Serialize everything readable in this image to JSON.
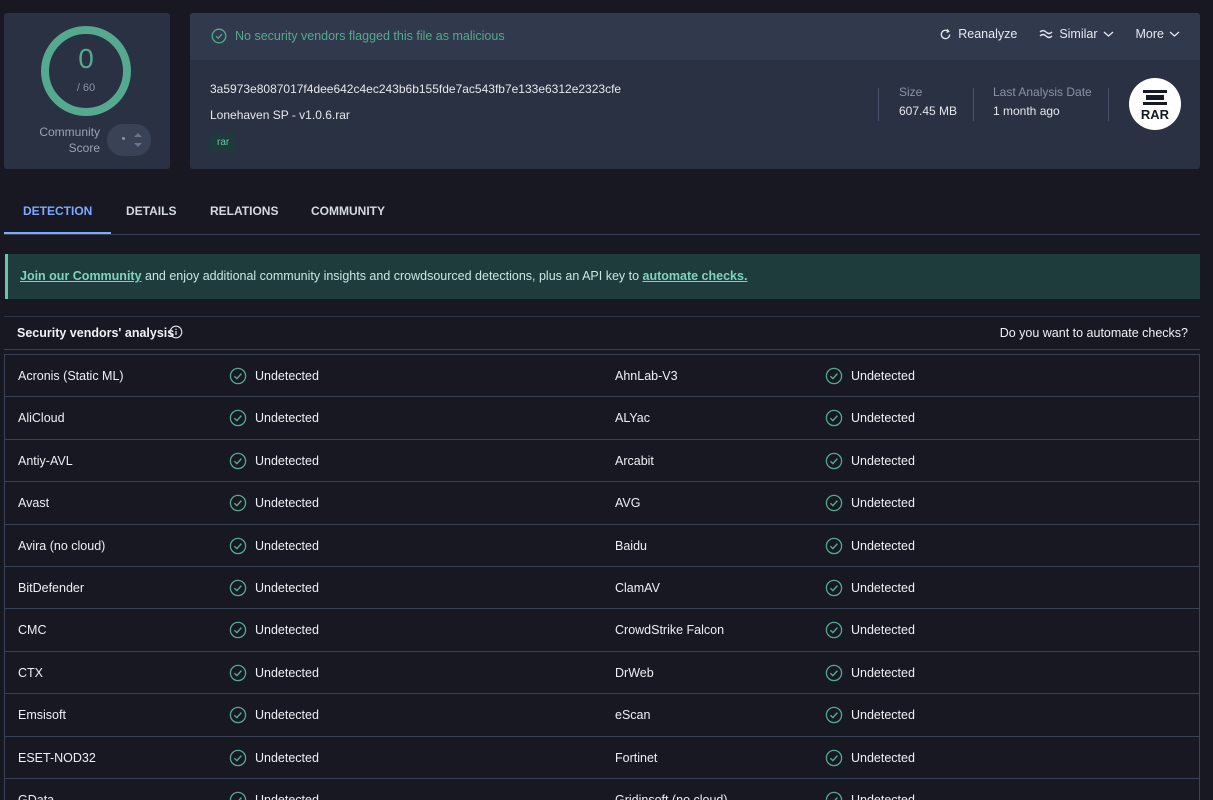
{
  "score": {
    "detections": "0",
    "total": "/ 60",
    "community_label_1": "Community",
    "community_label_2": "Score"
  },
  "header": {
    "status": "No security vendors flagged this file as malicious",
    "actions": {
      "reanalyze": "Reanalyze",
      "similar": "Similar",
      "more": "More"
    },
    "hash": "3a5973e8087017f4dee642c4ec243b6b155fde7ac543fb7e133e6312e2323cfe",
    "filename": "Lonehaven SP - v1.0.6.rar",
    "tag": "rar",
    "size_label": "Size",
    "size_value": "607.45 MB",
    "date_label": "Last Analysis Date",
    "date_value": "1 month ago",
    "file_icon": "RAR"
  },
  "tabs": [
    "DETECTION",
    "DETAILS",
    "RELATIONS",
    "COMMUNITY"
  ],
  "banner": {
    "link1": "Join our Community",
    "text": " and enjoy additional community insights and crowdsourced detections, plus an API key to ",
    "link2": "automate checks."
  },
  "vendors": {
    "title": "Security vendors' analysis",
    "automate_question": "Do you want to automate checks?",
    "rows": [
      [
        "Acronis (Static ML)",
        "Undetected",
        "AhnLab-V3",
        "Undetected"
      ],
      [
        "AliCloud",
        "Undetected",
        "ALYac",
        "Undetected"
      ],
      [
        "Antiy-AVL",
        "Undetected",
        "Arcabit",
        "Undetected"
      ],
      [
        "Avast",
        "Undetected",
        "AVG",
        "Undetected"
      ],
      [
        "Avira (no cloud)",
        "Undetected",
        "Baidu",
        "Undetected"
      ],
      [
        "BitDefender",
        "Undetected",
        "ClamAV",
        "Undetected"
      ],
      [
        "CMC",
        "Undetected",
        "CrowdStrike Falcon",
        "Undetected"
      ],
      [
        "CTX",
        "Undetected",
        "DrWeb",
        "Undetected"
      ],
      [
        "Emsisoft",
        "Undetected",
        "eScan",
        "Undetected"
      ],
      [
        "ESET-NOD32",
        "Undetected",
        "Fortinet",
        "Undetected"
      ],
      [
        "GData",
        "Undetected",
        "Gridinsoft (no cloud)",
        "Undetected"
      ]
    ]
  },
  "colors": {
    "accent": "#54a98e",
    "tab_active": "#7fa8ff",
    "bg": "#181823",
    "card": "#2a3142"
  }
}
